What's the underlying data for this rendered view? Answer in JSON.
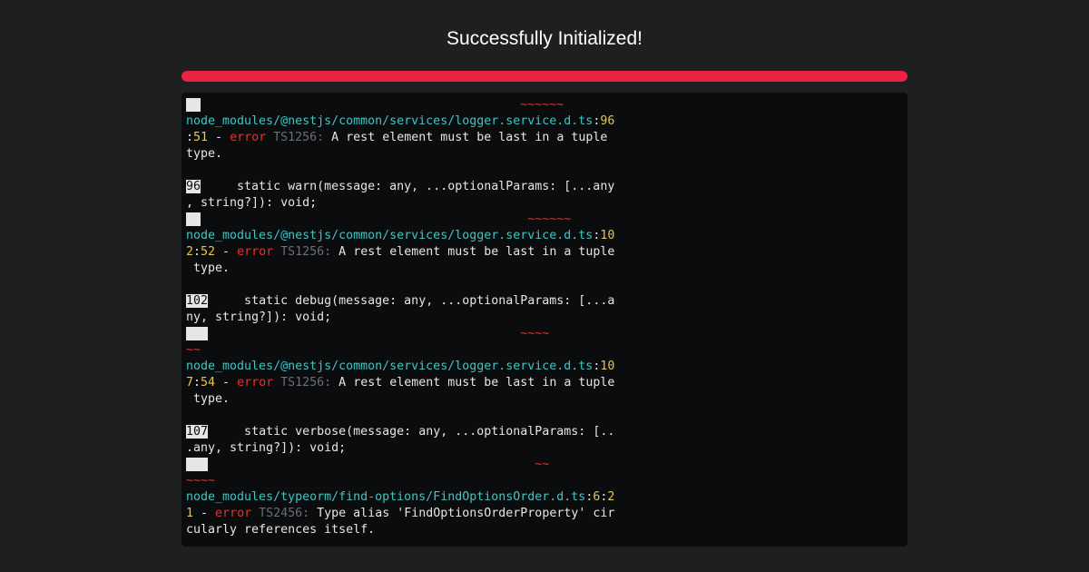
{
  "header": {
    "title": "Successfully Initialized!"
  },
  "progress": {
    "percent": 100,
    "color": "#ec2340"
  },
  "terminal": {
    "lines": [
      [
        {
          "t": "  ",
          "c": "ln"
        },
        {
          "t": "                                            ~~~~~~",
          "c": "tilde"
        }
      ],
      [
        {
          "t": "node_modules/@nestjs/common/services/logger.service.d.ts",
          "c": "cyan"
        },
        {
          "t": ":"
        },
        {
          "t": "96",
          "c": "yellow"
        }
      ],
      [
        {
          "t": ":"
        },
        {
          "t": "51",
          "c": "yellow"
        },
        {
          "t": " - "
        },
        {
          "t": "error",
          "c": "red"
        },
        {
          "t": " "
        },
        {
          "t": "TS1256:",
          "c": "gray"
        },
        {
          "t": " A rest element must be last in a tuple"
        }
      ],
      [
        {
          "t": "type."
        }
      ],
      [],
      [
        {
          "t": "96",
          "c": "ln"
        },
        {
          "t": "     static warn(message: any, ...optionalParams: [...any"
        }
      ],
      [
        {
          "t": ", string?]): void;"
        }
      ],
      [
        {
          "t": "  ",
          "c": "ln"
        },
        {
          "t": "                                             ~~~~~~",
          "c": "tilde"
        }
      ],
      [
        {
          "t": "node_modules/@nestjs/common/services/logger.service.d.ts",
          "c": "cyan"
        },
        {
          "t": ":"
        },
        {
          "t": "10",
          "c": "yellow"
        }
      ],
      [
        {
          "t": "2",
          "c": "yellow"
        },
        {
          "t": ":"
        },
        {
          "t": "52",
          "c": "yellow"
        },
        {
          "t": " - "
        },
        {
          "t": "error",
          "c": "red"
        },
        {
          "t": " "
        },
        {
          "t": "TS1256:",
          "c": "gray"
        },
        {
          "t": " A rest element must be last in a tuple"
        }
      ],
      [
        {
          "t": " type."
        }
      ],
      [],
      [
        {
          "t": "102",
          "c": "ln"
        },
        {
          "t": "     static debug(message: any, ...optionalParams: [...a"
        }
      ],
      [
        {
          "t": "ny, string?]): void;"
        }
      ],
      [
        {
          "t": "   ",
          "c": "ln"
        },
        {
          "t": "                                           ~~~~",
          "c": "tilde"
        }
      ],
      [
        {
          "t": "~~",
          "c": "tilde"
        }
      ],
      [
        {
          "t": "node_modules/@nestjs/common/services/logger.service.d.ts",
          "c": "cyan"
        },
        {
          "t": ":"
        },
        {
          "t": "10",
          "c": "yellow"
        }
      ],
      [
        {
          "t": "7",
          "c": "yellow"
        },
        {
          "t": ":"
        },
        {
          "t": "54",
          "c": "yellow"
        },
        {
          "t": " - "
        },
        {
          "t": "error",
          "c": "red"
        },
        {
          "t": " "
        },
        {
          "t": "TS1256:",
          "c": "gray"
        },
        {
          "t": " A rest element must be last in a tuple"
        }
      ],
      [
        {
          "t": " type."
        }
      ],
      [],
      [
        {
          "t": "107",
          "c": "ln"
        },
        {
          "t": "     static verbose(message: any, ...optionalParams: [.."
        }
      ],
      [
        {
          "t": ".any, string?]): void;"
        }
      ],
      [
        {
          "t": "   ",
          "c": "ln"
        },
        {
          "t": "                                             ~~",
          "c": "tilde"
        }
      ],
      [
        {
          "t": "~~~~",
          "c": "tilde"
        }
      ],
      [
        {
          "t": "node_modules/typeorm/find-options/FindOptionsOrder.d.ts",
          "c": "cyan"
        },
        {
          "t": ":"
        },
        {
          "t": "6",
          "c": "yellow"
        },
        {
          "t": ":"
        },
        {
          "t": "2",
          "c": "yellow"
        }
      ],
      [
        {
          "t": "1",
          "c": "yellow"
        },
        {
          "t": " - "
        },
        {
          "t": "error",
          "c": "red"
        },
        {
          "t": " "
        },
        {
          "t": "TS2456:",
          "c": "gray"
        },
        {
          "t": " Type alias 'FindOptionsOrderProperty' cir"
        }
      ],
      [
        {
          "t": "cularly references itself."
        }
      ]
    ]
  }
}
